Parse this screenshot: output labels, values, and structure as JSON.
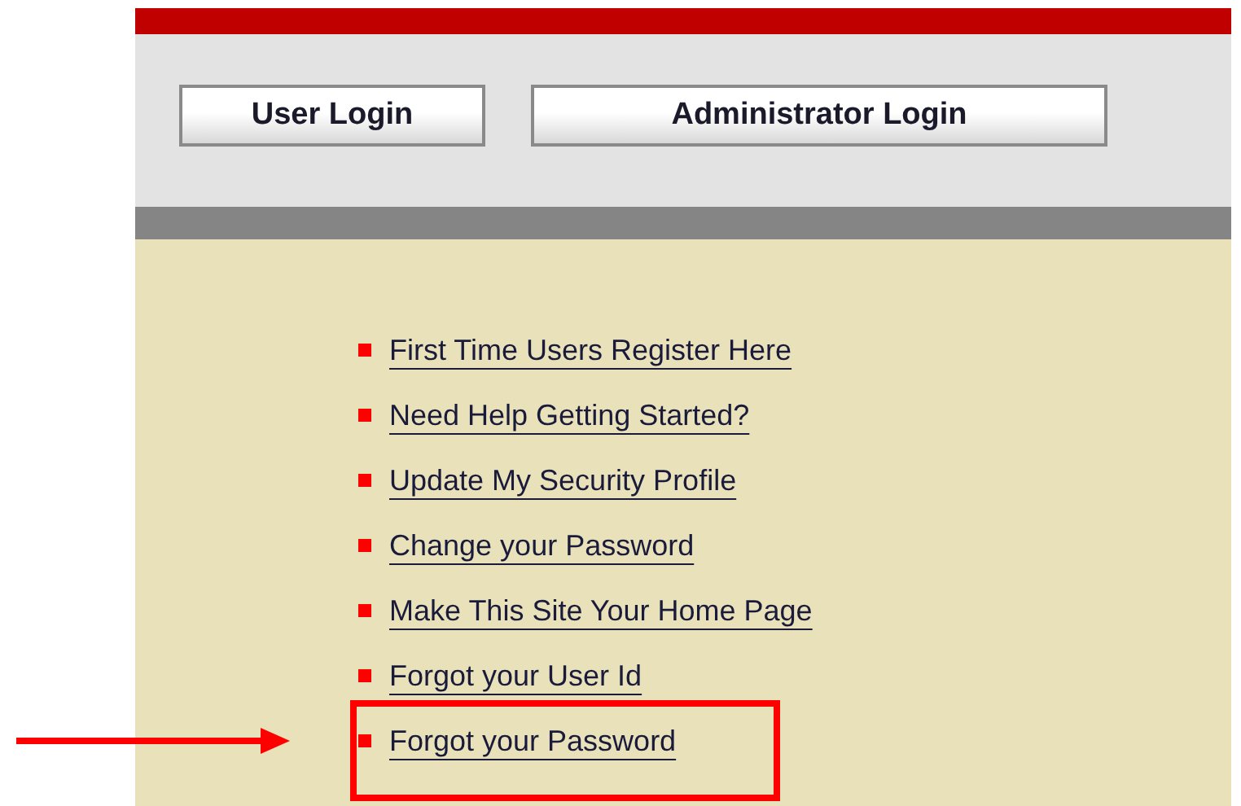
{
  "buttons": [
    "User Login",
    "Administrator Login"
  ],
  "links": [
    {
      "label": "First Time Users Register Here",
      "highlighted": false
    },
    {
      "label": "Need Help Getting Started?",
      "highlighted": false
    },
    {
      "label": "Update My Security Profile",
      "highlighted": false
    },
    {
      "label": "Change your Password",
      "highlighted": false
    },
    {
      "label": "Make This Site Your Home Page",
      "highlighted": false
    },
    {
      "label": "Forgot your User Id",
      "highlighted": false
    },
    {
      "label": "Forgot your Password",
      "highlighted": true
    }
  ]
}
